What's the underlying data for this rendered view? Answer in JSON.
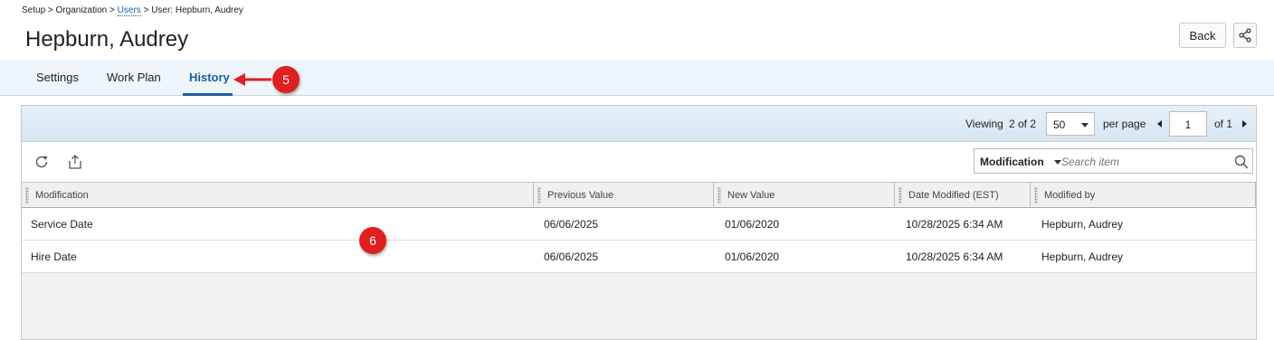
{
  "breadcrumb": {
    "setup": "Setup",
    "sep1": ">",
    "organization": "Organization",
    "sep2": ">",
    "users": "Users",
    "sep3": ">",
    "current": "User: Hepburn, Audrey"
  },
  "page_title": "Hepburn, Audrey",
  "header_actions": {
    "back_label": "Back",
    "share_icon": "share-icon"
  },
  "tabs": [
    {
      "label": "Settings",
      "active": false
    },
    {
      "label": "Work Plan",
      "active": false
    },
    {
      "label": "History",
      "active": true
    }
  ],
  "callouts": {
    "tab_marker": "5",
    "table_marker": "6"
  },
  "pager": {
    "viewing_label": "Viewing",
    "viewing_value": "2 of 2",
    "page_size": "50",
    "per_page_label": "per page",
    "current_page": "1",
    "of_label": "of 1"
  },
  "toolbar": {
    "refresh_icon": "refresh-icon",
    "export_icon": "export-icon",
    "search_filter": "Modification",
    "search_placeholder": "Search item"
  },
  "table": {
    "columns": [
      "Modification",
      "Previous Value",
      "New Value",
      "Date Modified (EST)",
      "Modified by"
    ],
    "rows": [
      [
        "Service Date",
        "06/06/2025",
        "01/06/2020",
        "10/28/2025 6:34 AM",
        "Hepburn, Audrey"
      ],
      [
        "Hire Date",
        "06/06/2025",
        "01/06/2020",
        "10/28/2025 6:34 AM",
        "Hepburn, Audrey"
      ]
    ]
  },
  "colors": {
    "accent": "#1a5fa8",
    "callout": "#e01f1f",
    "tabbar_bg": "#eef5fb"
  }
}
